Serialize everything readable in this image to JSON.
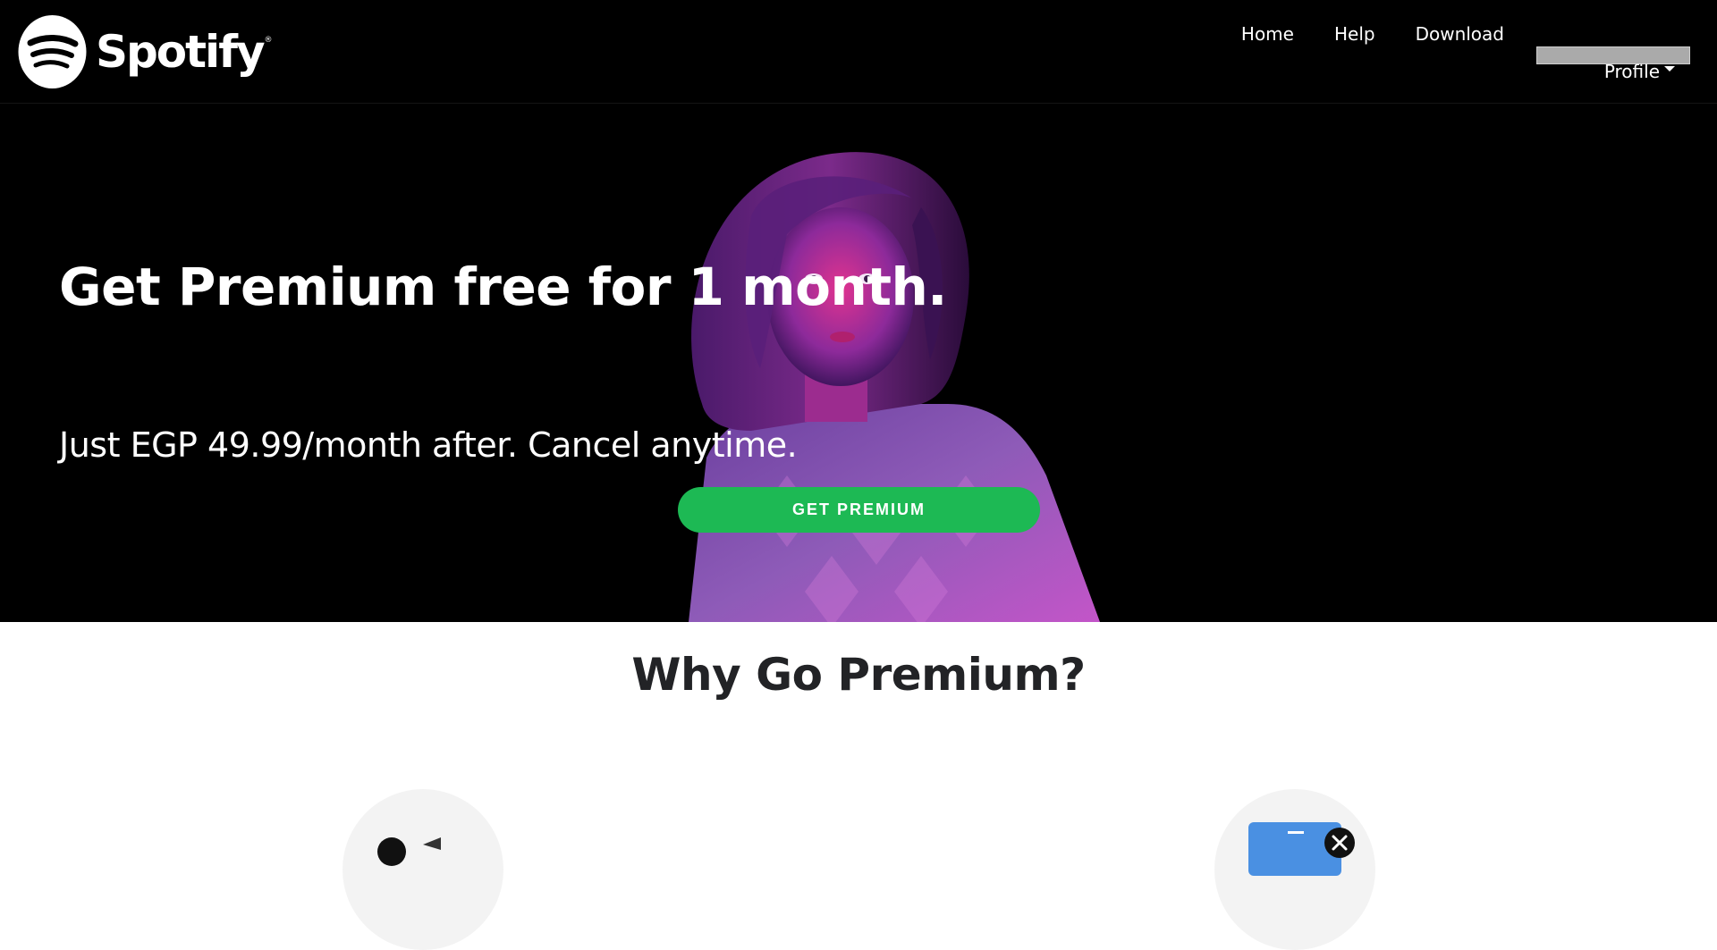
{
  "brand": {
    "name": "Spotify",
    "registered_mark": "®",
    "color": "#1db954"
  },
  "header": {
    "nav": [
      {
        "label": "Home"
      },
      {
        "label": "Help"
      },
      {
        "label": "Download"
      }
    ],
    "profile_label": "Profile",
    "profile_icon": "caret-down-icon"
  },
  "hero": {
    "title": "Get Premium free for 1 month.",
    "subtitle": "Just EGP 49.99/month after. Cancel anytime.",
    "cta_label": "GET PREMIUM"
  },
  "why": {
    "title": "Why Go Premium?",
    "features": [
      {
        "icon": "download-music-icon"
      },
      {
        "icon": "no-ads-icon"
      }
    ]
  }
}
